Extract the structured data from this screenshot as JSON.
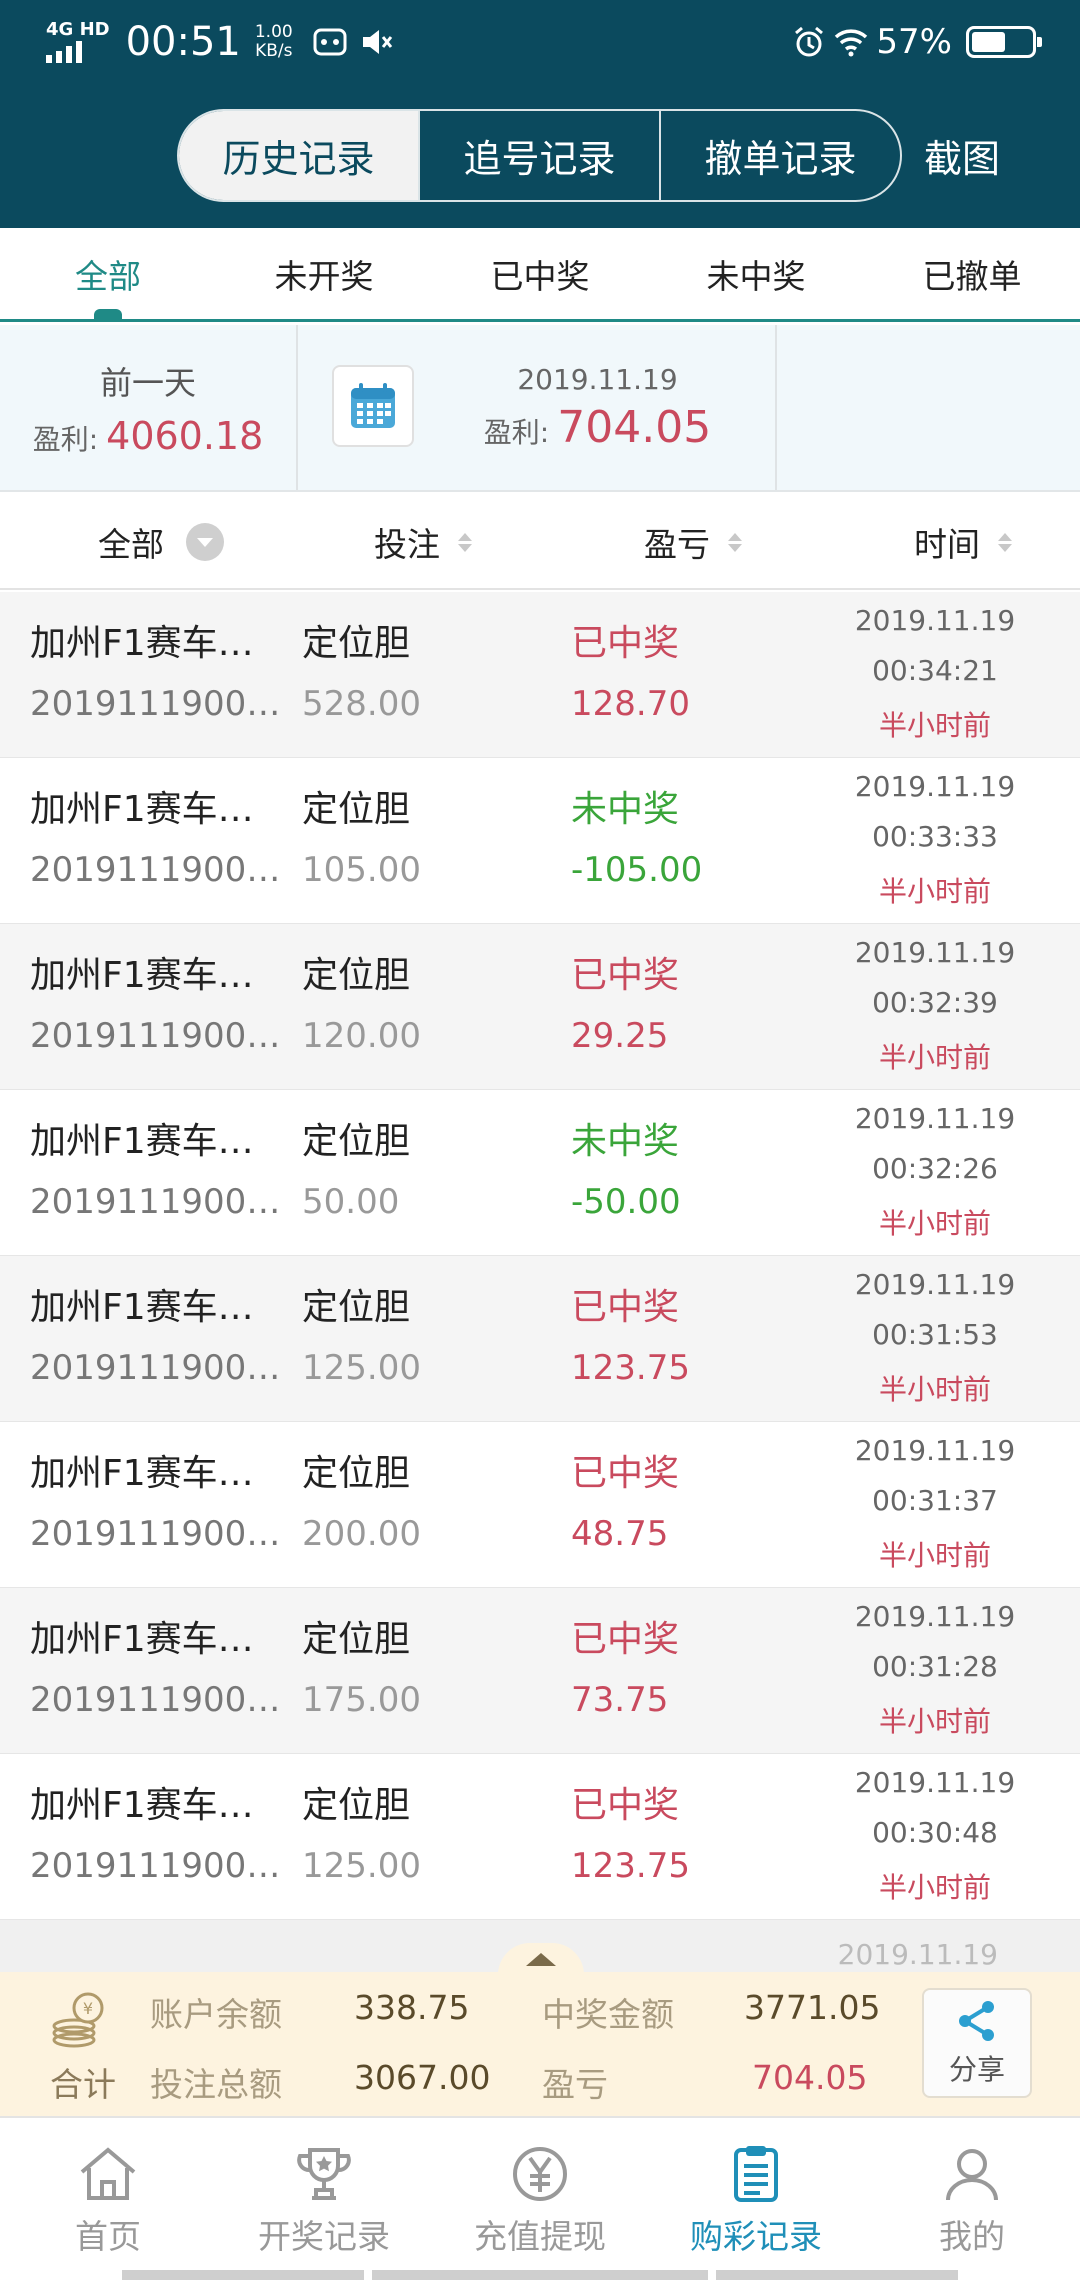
{
  "status_bar": {
    "network": "4G HD",
    "time": "00:51",
    "speed_value": "1.00",
    "speed_unit": "KB/s",
    "battery": "57%",
    "battery_level": 0.57,
    "icons": [
      "signal-icon",
      "vivo-app-icon",
      "mute-icon",
      "alarm-icon",
      "wifi-icon",
      "battery-icon"
    ]
  },
  "header": {
    "tabs": [
      "历史记录",
      "追号记录",
      "撤单记录"
    ],
    "active_tab": 0,
    "screenshot": "截图"
  },
  "filter_tabs": [
    "全部",
    "未开奖",
    "已中奖",
    "未中奖",
    "已撤单"
  ],
  "summary": {
    "prev_day_label": "前一天",
    "profit_label": "盈利:",
    "prev_profit": "4060.18",
    "current_date": "2019.11.19",
    "current_profit": "704.05"
  },
  "columns": {
    "all": "全部",
    "bet": "投注",
    "profit_loss": "盈亏",
    "time": "时间"
  },
  "records": [
    {
      "name": "加州F1赛车…",
      "issue": "2019111900…",
      "type": "定位胆",
      "amount": "528.00",
      "status": "已中奖",
      "pl": "128.70",
      "win": true,
      "date": "2019.11.19",
      "time": "00:34:21",
      "ago": "半小时前"
    },
    {
      "name": "加州F1赛车…",
      "issue": "2019111900…",
      "type": "定位胆",
      "amount": "105.00",
      "status": "未中奖",
      "pl": "-105.00",
      "win": false,
      "date": "2019.11.19",
      "time": "00:33:33",
      "ago": "半小时前"
    },
    {
      "name": "加州F1赛车…",
      "issue": "2019111900…",
      "type": "定位胆",
      "amount": "120.00",
      "status": "已中奖",
      "pl": "29.25",
      "win": true,
      "date": "2019.11.19",
      "time": "00:32:39",
      "ago": "半小时前"
    },
    {
      "name": "加州F1赛车…",
      "issue": "2019111900…",
      "type": "定位胆",
      "amount": "50.00",
      "status": "未中奖",
      "pl": "-50.00",
      "win": false,
      "date": "2019.11.19",
      "time": "00:32:26",
      "ago": "半小时前"
    },
    {
      "name": "加州F1赛车…",
      "issue": "2019111900…",
      "type": "定位胆",
      "amount": "125.00",
      "status": "已中奖",
      "pl": "123.75",
      "win": true,
      "date": "2019.11.19",
      "time": "00:31:53",
      "ago": "半小时前"
    },
    {
      "name": "加州F1赛车…",
      "issue": "2019111900…",
      "type": "定位胆",
      "amount": "200.00",
      "status": "已中奖",
      "pl": "48.75",
      "win": true,
      "date": "2019.11.19",
      "time": "00:31:37",
      "ago": "半小时前"
    },
    {
      "name": "加州F1赛车…",
      "issue": "2019111900…",
      "type": "定位胆",
      "amount": "175.00",
      "status": "已中奖",
      "pl": "73.75",
      "win": true,
      "date": "2019.11.19",
      "time": "00:31:28",
      "ago": "半小时前"
    },
    {
      "name": "加州F1赛车…",
      "issue": "2019111900…",
      "type": "定位胆",
      "amount": "125.00",
      "status": "已中奖",
      "pl": "123.75",
      "win": true,
      "date": "2019.11.19",
      "time": "00:30:48",
      "ago": "半小时前"
    }
  ],
  "peek_date": "2019.11.19",
  "totals": {
    "heji": "合计",
    "balance_label": "账户余额",
    "balance": "338.75",
    "prize_label": "中奖金额",
    "prize": "3771.05",
    "bet_total_label": "投注总额",
    "bet_total": "3067.00",
    "pl_label": "盈亏",
    "pl": "704.05",
    "share": "分享"
  },
  "bottom_nav": [
    {
      "label": "首页",
      "icon": "home-icon"
    },
    {
      "label": "开奖记录",
      "icon": "trophy-icon"
    },
    {
      "label": "充值提现",
      "icon": "yuan-icon"
    },
    {
      "label": "购彩记录",
      "icon": "clipboard-icon",
      "active": true
    },
    {
      "label": "我的",
      "icon": "user-icon"
    }
  ],
  "colors": {
    "header_bg": "#0b4a5e",
    "accent_teal": "#1f8a86",
    "win_red": "#c94a5e",
    "lose_green": "#3aa53a",
    "nav_active": "#1f8fb8",
    "totals_bg": "#fdf3df"
  }
}
